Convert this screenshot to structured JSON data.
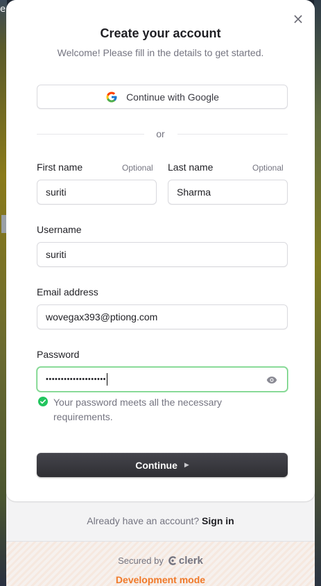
{
  "background": {
    "edge_letter": "e"
  },
  "dialog": {
    "close_icon": "×",
    "title": "Create your account",
    "subtitle": "Welcome! Please fill in the details to get started.",
    "google_button_label": "Continue with Google",
    "divider_text": "or"
  },
  "form": {
    "first_name": {
      "label": "First name",
      "optional": "Optional",
      "value": "suriti"
    },
    "last_name": {
      "label": "Last name",
      "optional": "Optional",
      "value": "Sharma"
    },
    "username": {
      "label": "Username",
      "value": "suriti"
    },
    "email": {
      "label": "Email address",
      "value": "wovegax393@ptiong.com"
    },
    "password": {
      "label": "Password",
      "masked_value": "••••••••••••••••••••"
    },
    "password_success": "Your password meets all the necessary requirements.",
    "continue_label": "Continue"
  },
  "footer": {
    "signin_prompt": "Already have an account?",
    "signin_link": "Sign in",
    "secured_by": "Secured by",
    "clerk_brand": "clerk",
    "dev_mode": "Development mode"
  },
  "colors": {
    "accent_success": "#22c55e",
    "dev_mode": "#f07a2a",
    "button_dark": "#2e2e33"
  }
}
